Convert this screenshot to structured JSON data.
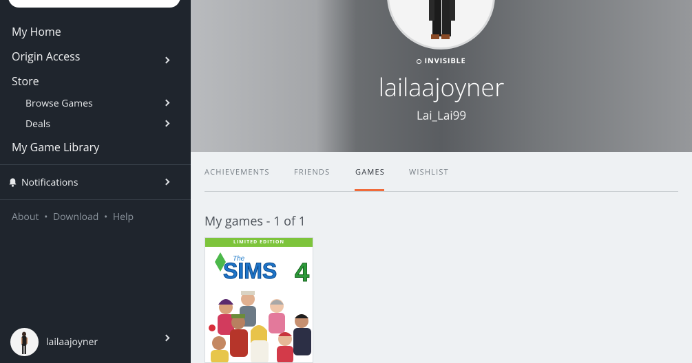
{
  "sidebar": {
    "nav": [
      {
        "label": "My Home"
      },
      {
        "label": "Origin Access"
      },
      {
        "label": "Store"
      }
    ],
    "store_sub": [
      {
        "label": "Browse Games"
      },
      {
        "label": "Deals"
      }
    ],
    "library": "My Game Library",
    "notifications": "Notifications",
    "footer": {
      "about": "About",
      "download": "Download",
      "help": "Help",
      "sep": "•"
    },
    "user": {
      "name": "lailaajoyner"
    }
  },
  "profile": {
    "status": "INVISIBLE",
    "username": "lailaajoyner",
    "origin_id": "Lai_Lai99"
  },
  "tabs": [
    {
      "label": "ACHIEVEMENTS"
    },
    {
      "label": "FRIENDS"
    },
    {
      "label": "GAMES"
    },
    {
      "label": "WISHLIST"
    }
  ],
  "games": {
    "title": "My games - 1 of 1",
    "items": [
      {
        "banner": "LIMITED EDITION",
        "name_small": "The",
        "name_big": "SIMS",
        "number": "4"
      }
    ]
  },
  "colors": {
    "accent": "#f06b3a",
    "sidebar": "#1f252d",
    "sims_green": "#7dc43b"
  }
}
